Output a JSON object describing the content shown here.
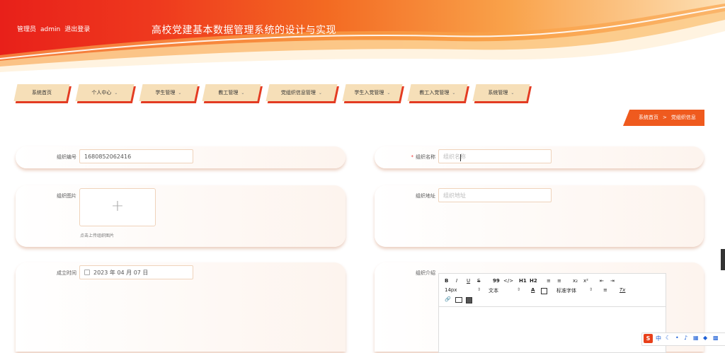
{
  "header": {
    "user_role": "管理员",
    "username": "admin",
    "logout": "退出登录",
    "site_title": "高校党建基本数据管理系统的设计与实现"
  },
  "nav": {
    "items": [
      {
        "label": "系统首页",
        "has_dropdown": false
      },
      {
        "label": "个人中心",
        "has_dropdown": true
      },
      {
        "label": "学生管理",
        "has_dropdown": true
      },
      {
        "label": "教工管理",
        "has_dropdown": true
      },
      {
        "label": "党组织信息管理",
        "has_dropdown": true
      },
      {
        "label": "学生入党管理",
        "has_dropdown": true
      },
      {
        "label": "教工入党管理",
        "has_dropdown": true
      },
      {
        "label": "系统管理",
        "has_dropdown": true
      }
    ],
    "chevron": "⌄"
  },
  "breadcrumb": {
    "home": "系统首页",
    "separator": ">",
    "current": "党组织信息"
  },
  "form": {
    "org_no": {
      "label": "组织编号",
      "value": "1680852062416"
    },
    "org_name": {
      "label": "组织名称",
      "required_mark": "*",
      "placeholder": "组织名称"
    },
    "org_image": {
      "label": "组织图片",
      "upload_plus": "+",
      "upload_hint": "点击上传组织图片"
    },
    "org_address": {
      "label": "组织地址",
      "placeholder": "组织地址"
    },
    "founded": {
      "label": "成立时间",
      "value": "2023 年 04 月 07 日"
    },
    "intro": {
      "label": "组织介绍"
    }
  },
  "editor": {
    "row1": [
      "B",
      "I",
      "U",
      "S",
      "99",
      "</>",
      "H1",
      "H2",
      "≡",
      "≡",
      "x₂",
      "x²",
      "⇤",
      "⇥"
    ],
    "font_size": "14px",
    "text_style": "文本",
    "font_family": "标准字体",
    "color_a": "A",
    "align": "≡",
    "clear": "Tx"
  },
  "ime": {
    "logo": "S",
    "lang": "中"
  },
  "colors": {
    "accent": "#ef5a1e",
    "nav_bg": "#f6dfb8",
    "nav_shadow": "#e33b22"
  }
}
